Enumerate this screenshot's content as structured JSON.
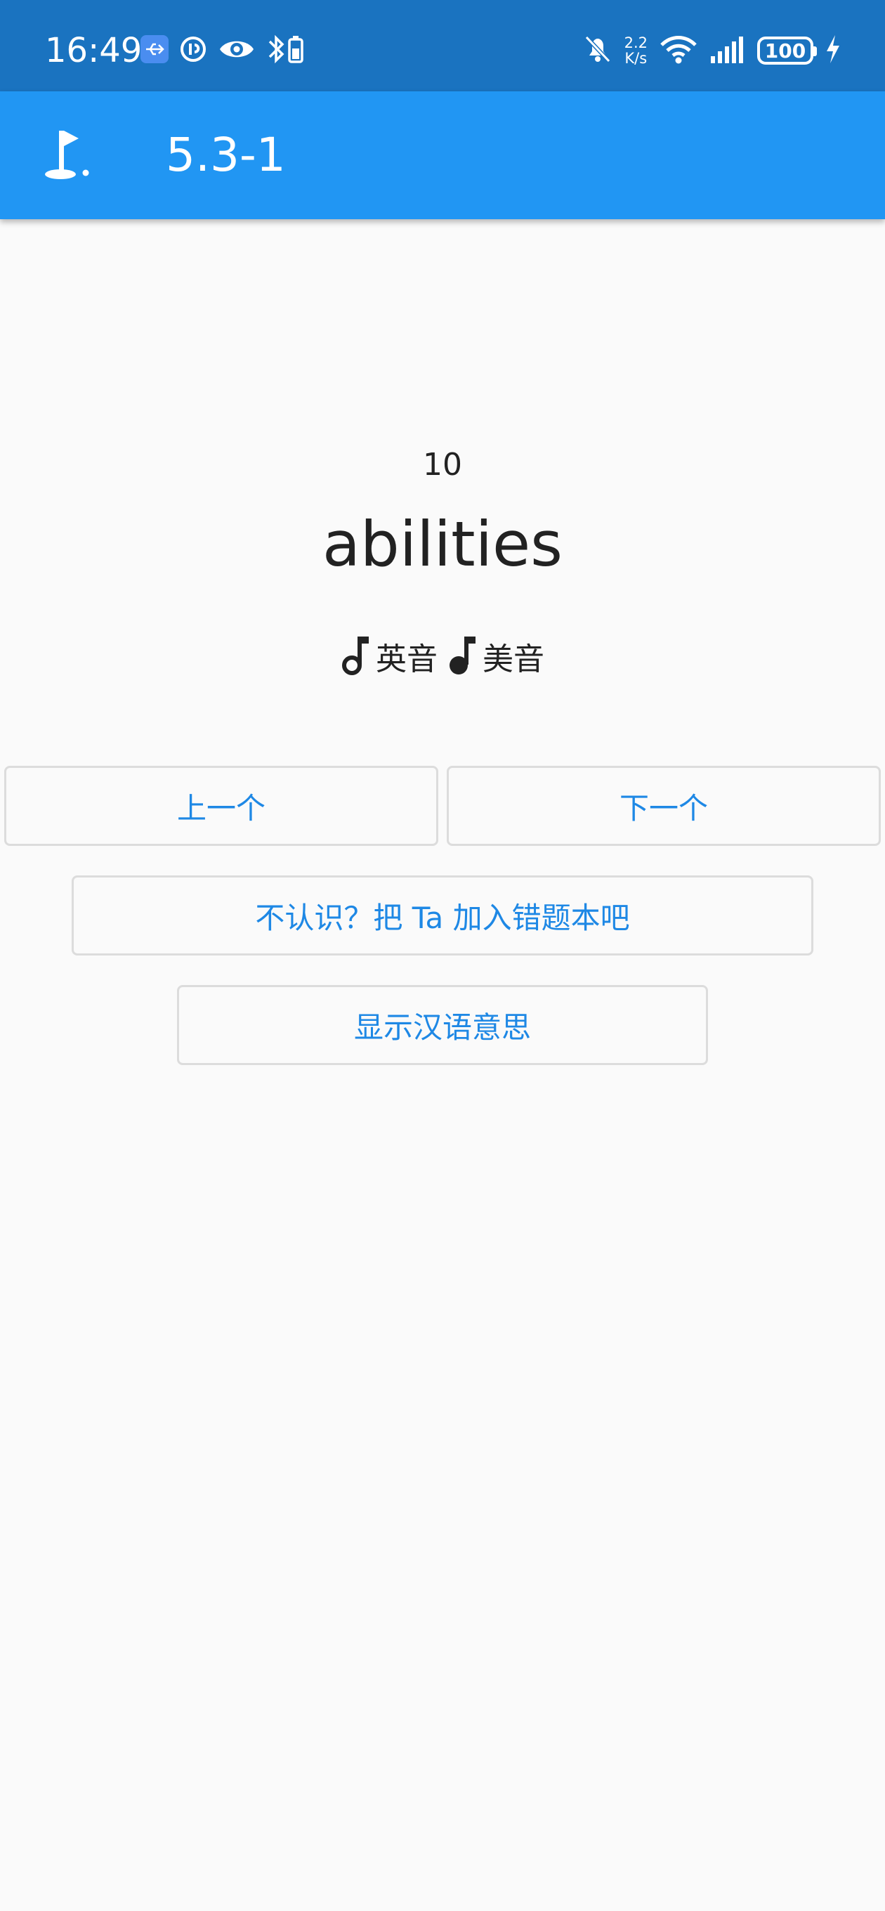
{
  "status_bar": {
    "time": "16:49",
    "net_speed_value": "2.2",
    "net_speed_unit": "K/s",
    "battery": "100",
    "left_icons": [
      "usb-debug-icon",
      "data-saver-icon",
      "eye-icon",
      "bluetooth-battery-icon"
    ],
    "right_icons": [
      "mute-bell-icon",
      "wifi-icon",
      "signal-icon",
      "battery-icon",
      "charging-icon"
    ]
  },
  "app_bar": {
    "icon": "golf-flag-icon",
    "title": "5.3-1",
    "background": "#2196f3"
  },
  "word": {
    "index": "10",
    "text": "abilities"
  },
  "pronunciation": {
    "uk_label": "英音",
    "us_label": "美音",
    "icon": "music-note-icon"
  },
  "buttons": {
    "prev": "上一个",
    "next": "下一个",
    "add_to_wrong_book": "不认识？把 Ta 加入错题本吧",
    "show_meaning": "显示汉语意思"
  },
  "colors": {
    "status_bar": "#1a73c0",
    "accent": "#1e88e5",
    "background": "#fafafa"
  }
}
